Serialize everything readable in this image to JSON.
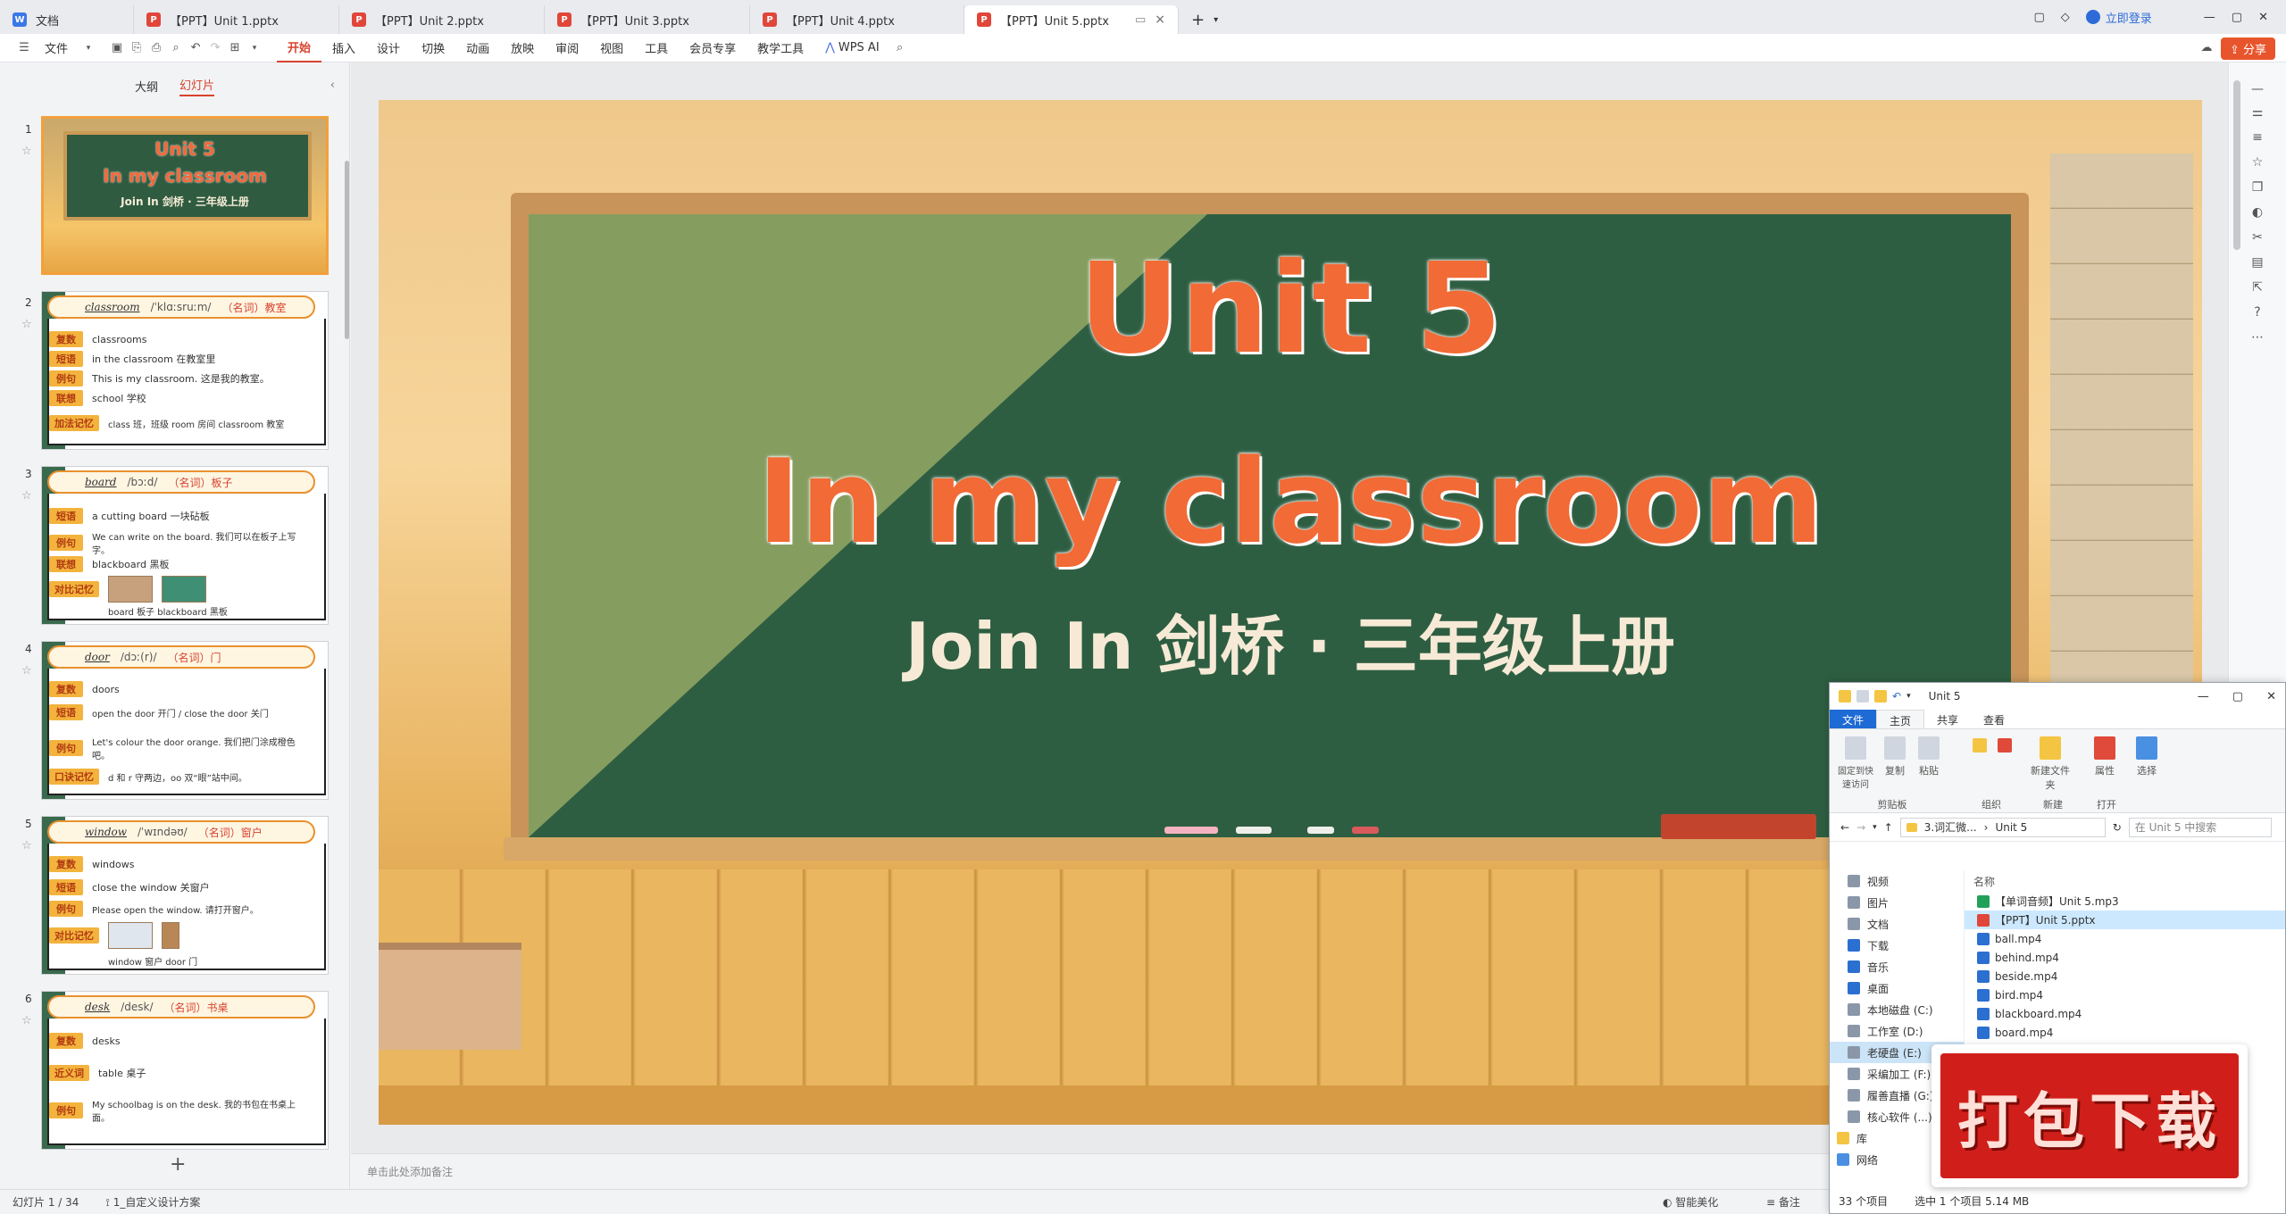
{
  "tabs": [
    {
      "label": "文档",
      "type": "doc"
    },
    {
      "label": "【PPT】Unit 1.pptx",
      "type": "ppt"
    },
    {
      "label": "【PPT】Unit 2.pptx",
      "type": "ppt"
    },
    {
      "label": "【PPT】Unit 3.pptx",
      "type": "ppt"
    },
    {
      "label": "【PPT】Unit 4.pptx",
      "type": "ppt"
    },
    {
      "label": "【PPT】Unit 5.pptx",
      "type": "ppt",
      "active": true
    }
  ],
  "login_label": "立即登录",
  "share_label": "分享",
  "ribbon": {
    "file_menu": "文件",
    "menu": [
      "开始",
      "插入",
      "设计",
      "切换",
      "动画",
      "放映",
      "审阅",
      "视图",
      "工具",
      "会员专享",
      "教学工具"
    ],
    "active": "开始",
    "wps_ai": "WPS AI"
  },
  "left_panel": {
    "tab_outline": "大纲",
    "tab_slides": "幻灯片",
    "slide_numbers": [
      "1",
      "2",
      "3",
      "4",
      "5",
      "6"
    ],
    "thumb1": {
      "title1": "Unit 5",
      "title2": "In my classroom",
      "subtitle": "Join In 剑桥 · 三年级上册"
    },
    "thumb2": {
      "word": "classroom",
      "phon": "/ˈklɑːsruːm/",
      "pos": "（名词）教室",
      "rows": [
        [
          "复数",
          "classrooms"
        ],
        [
          "短语",
          "in the classroom 在教室里"
        ],
        [
          "例句",
          "This is my classroom. 这是我的教室。"
        ],
        [
          "联想",
          "school 学校"
        ],
        [
          "加法记忆",
          "class 班，班级   room 房间   classroom 教室"
        ]
      ]
    },
    "thumb3": {
      "word": "board",
      "phon": "/bɔːd/",
      "pos": "（名词）板子",
      "rows": [
        [
          "短语",
          "a cutting board 一块砧板"
        ],
        [
          "例句",
          "We can write on the board. 我们可以在板子上写字。"
        ],
        [
          "联想",
          "blackboard 黑板"
        ],
        [
          "对比记忆",
          "board 板子   blackboard 黑板"
        ]
      ]
    },
    "thumb4": {
      "word": "door",
      "phon": "/dɔː(r)/",
      "pos": "（名词）门",
      "rows": [
        [
          "复数",
          "doors"
        ],
        [
          "短语",
          "open the door 开门 / close the door 关门"
        ],
        [
          "例句",
          "Let's colour the door orange. 我们把门涂成橙色吧。"
        ],
        [
          "口诀记忆",
          "d 和 r 守两边，oo 双“眼”站中间。"
        ]
      ]
    },
    "thumb5": {
      "word": "window",
      "phon": "/ˈwɪndəʊ/",
      "pos": "（名词）窗户",
      "rows": [
        [
          "复数",
          "windows"
        ],
        [
          "短语",
          "close the window 关窗户"
        ],
        [
          "例句",
          "Please open the window. 请打开窗户。"
        ],
        [
          "对比记忆",
          "window 窗户   door 门"
        ]
      ]
    },
    "thumb6": {
      "word": "desk",
      "phon": "/desk/",
      "pos": "（名词）书桌",
      "rows": [
        [
          "复数",
          "desks"
        ],
        [
          "近义词",
          "table 桌子"
        ],
        [
          "例句",
          "My schoolbag is on the desk. 我的书包在书桌上面。"
        ]
      ]
    }
  },
  "slide": {
    "title_line1": "Unit 5",
    "title_line2": "In my classroom",
    "subtitle": "Join In 剑桥 · 三年级上册"
  },
  "notes_placeholder": "单击此处添加备注",
  "status": {
    "slide_count": "幻灯片 1 / 34",
    "theme": "1_自定义设计方案",
    "smart_beautify": "智能美化",
    "notes": "备注"
  },
  "explorer": {
    "title": "Unit 5",
    "tabs": [
      "文件",
      "主页",
      "共享",
      "查看"
    ],
    "ribbon_groups": [
      "剪贴板",
      "组织",
      "新建",
      "打开",
      "选择"
    ],
    "ribbon_buttons": [
      "固定到快速访问",
      "复制",
      "粘贴",
      "新建文件夹",
      "属性",
      "选择"
    ],
    "path": [
      "3.词汇微...",
      "Unit 5"
    ],
    "search_placeholder": "在 Unit 5 中搜索",
    "nav": [
      "视频",
      "图片",
      "文档",
      "下载",
      "音乐",
      "桌面",
      "本地磁盘 (C:)",
      "工作室 (D:)",
      "老硬盘 (E:)",
      "采编加工 (F:)",
      "履善直播 (G:)",
      "核心软件 (...)",
      "库",
      "网络"
    ],
    "nav_selected": "老硬盘 (E:)",
    "list_header": "名称",
    "files": [
      {
        "name": "【单词音频】Unit 5.mp3",
        "type": "mp3"
      },
      {
        "name": "【PPT】Unit 5.pptx",
        "type": "ppt",
        "selected": true
      },
      {
        "name": "ball.mp4",
        "type": "mp4"
      },
      {
        "name": "behind.mp4",
        "type": "mp4"
      },
      {
        "name": "beside.mp4",
        "type": "mp4"
      },
      {
        "name": "bird.mp4",
        "type": "mp4"
      },
      {
        "name": "blackboard.mp4",
        "type": "mp4"
      },
      {
        "name": "board.mp4",
        "type": "mp4"
      }
    ],
    "status_items": "33 个项目",
    "status_selected": "选中 1 个项目  5.14 MB"
  },
  "badge_text": "打包下载"
}
